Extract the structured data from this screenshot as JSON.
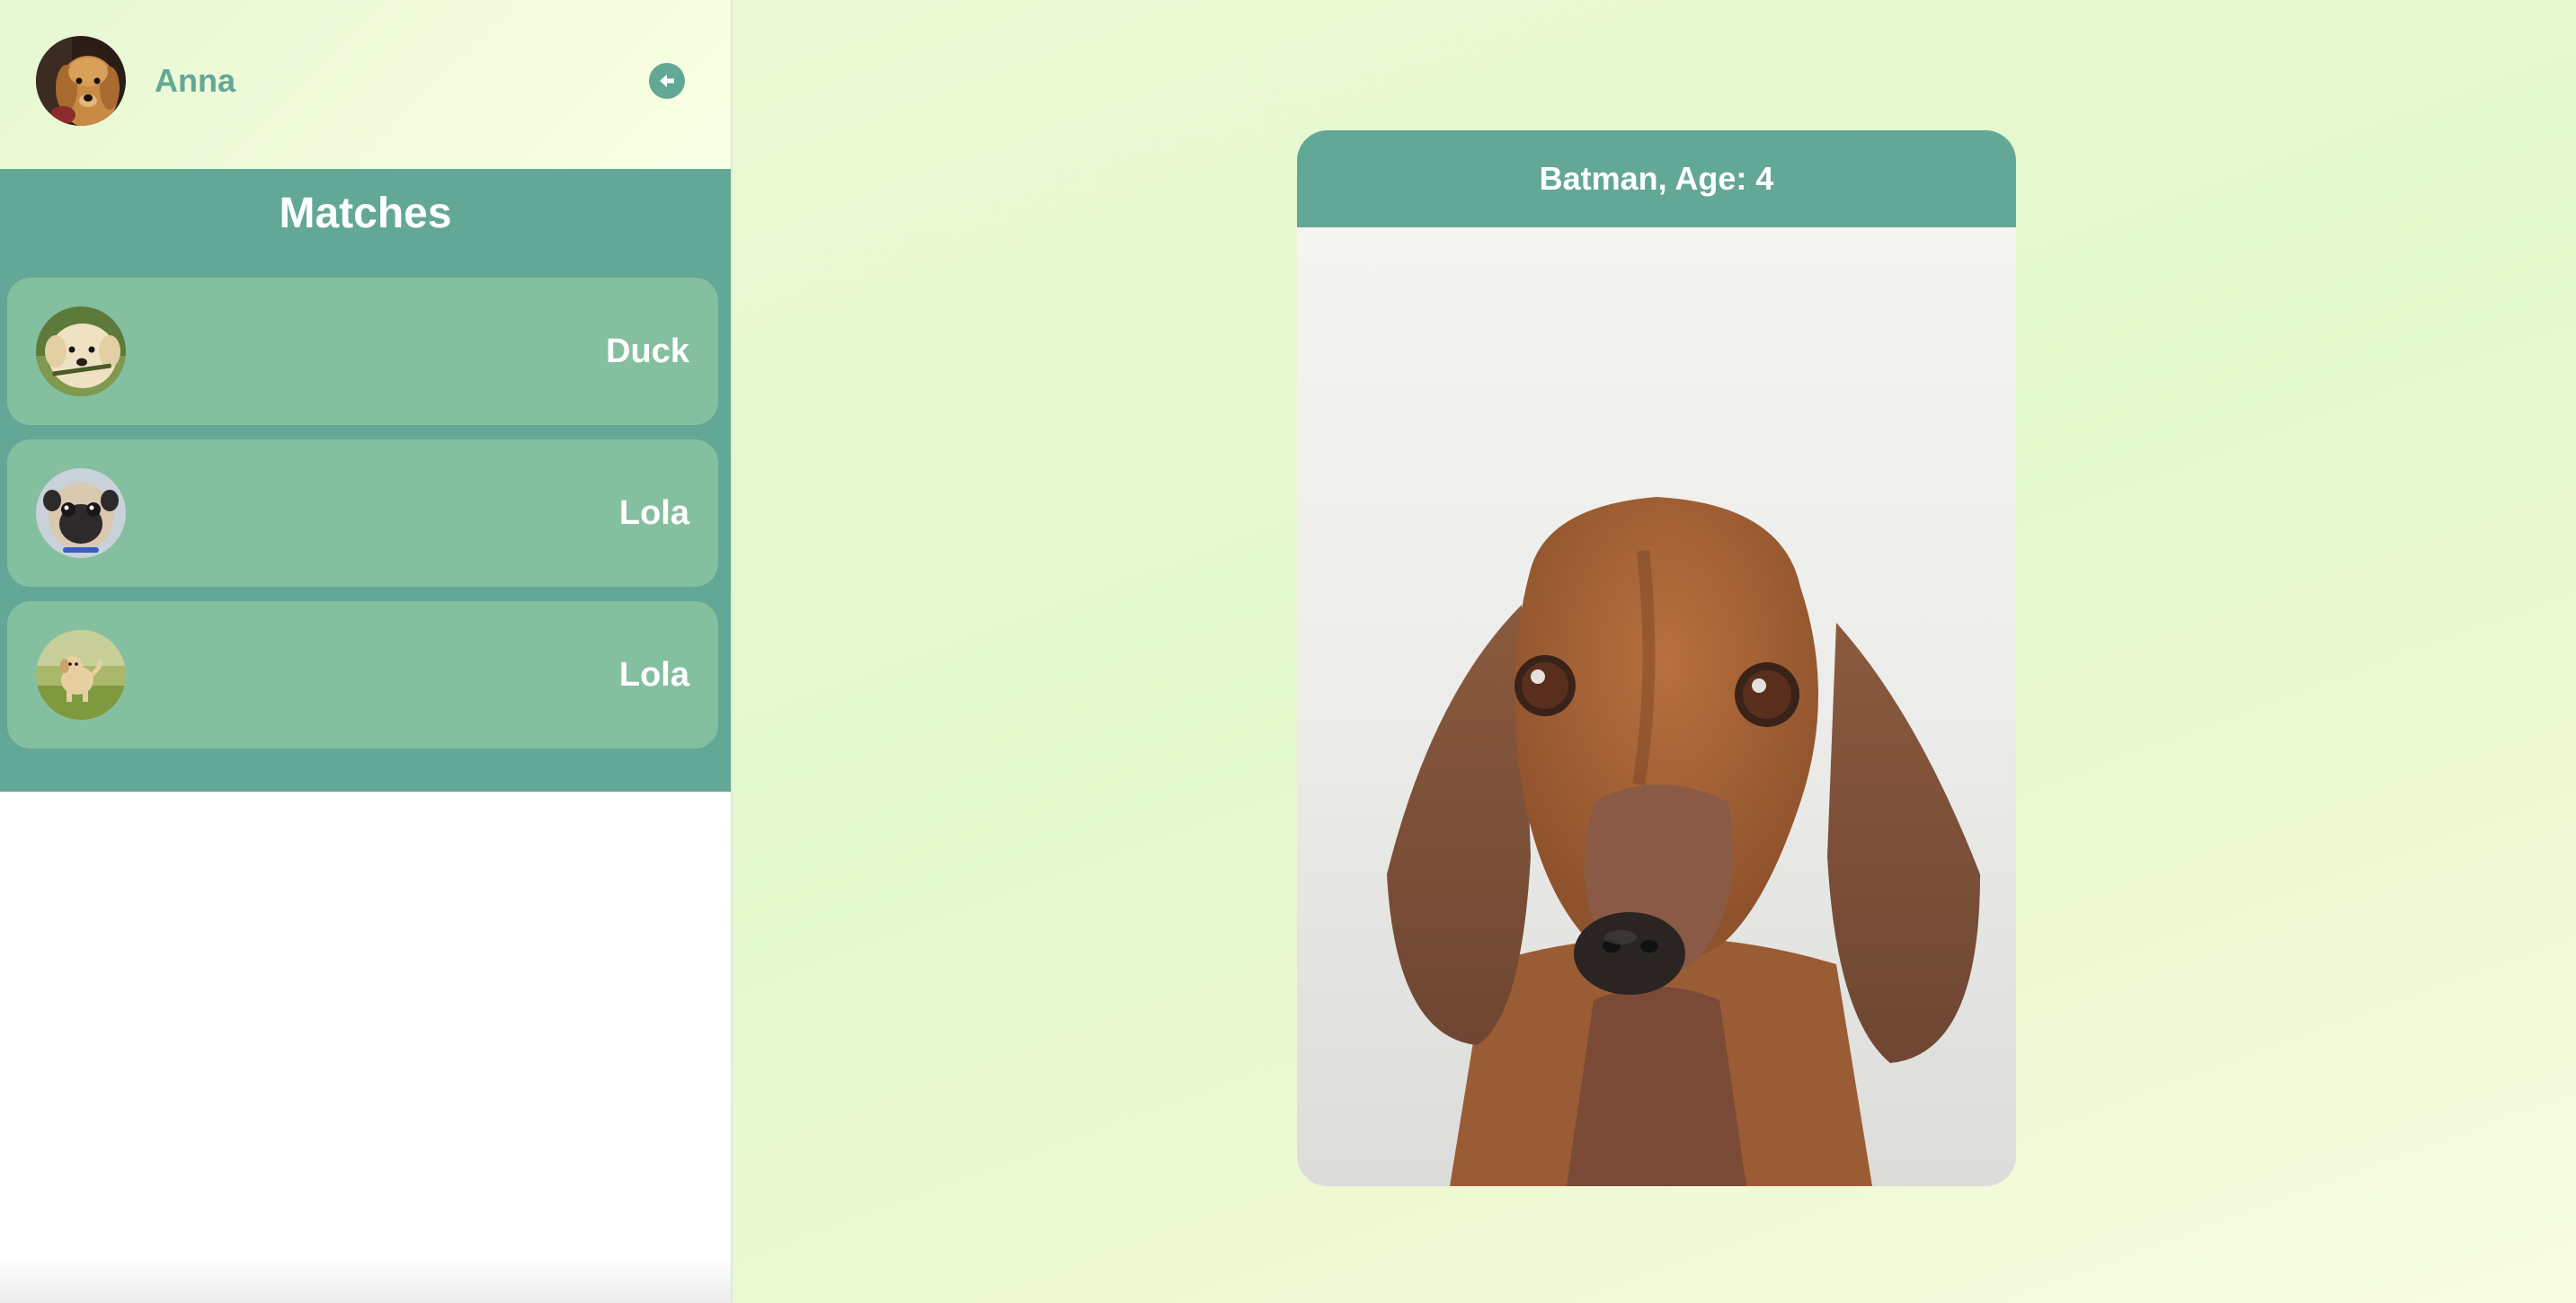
{
  "user": {
    "name": "Anna",
    "avatar": "golden-retriever-avatar"
  },
  "header": {
    "logout_icon": "arrow-left-icon"
  },
  "matches": {
    "title": "Matches",
    "items": [
      {
        "name": "Duck",
        "avatar": "golden-puppy-avatar"
      },
      {
        "name": "Lola",
        "avatar": "pug-avatar"
      },
      {
        "name": "Lola",
        "avatar": "puppy-in-grass-avatar"
      }
    ]
  },
  "card": {
    "title": "Batman, Age: 4",
    "photo": "dachshund-photo"
  },
  "colors": {
    "accent": "#63a896",
    "match_card": "#84bf9f",
    "background_light": "#e8f8d0"
  }
}
